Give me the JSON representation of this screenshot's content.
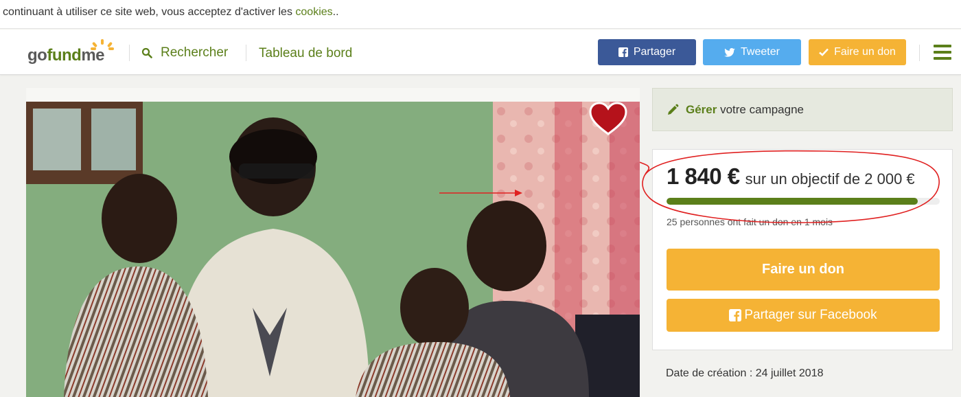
{
  "cookie_bar": {
    "text": "continuant à utiliser ce site web, vous acceptez d'activer les ",
    "link": "cookies",
    "suffix": ".."
  },
  "header": {
    "logo": {
      "go": "go",
      "fund": "fund",
      "me": "me"
    },
    "search_label": "Rechercher",
    "dashboard_label": "Tableau de bord",
    "share_label": "Partager",
    "tweet_label": "Tweeter",
    "donate_label": "Faire un don"
  },
  "campaign": {
    "manage_bold": "Gérer",
    "manage_rest": " votre campagne",
    "raised": "1 840 €",
    "goal_text": "sur un objectif de 2 000 €",
    "progress_fraction": 0.92,
    "donors_text": "25 personnes ont fait un don en 1 mois",
    "donate_button": "Faire un don",
    "share_button": "Partager sur Facebook",
    "creation_date": "Date de création : 24 juillet 2018"
  },
  "colors": {
    "brand_green": "#5b7f1a",
    "facebook": "#3b5998",
    "twitter": "#55acee",
    "donate_orange": "#f5b335",
    "annotation_red": "#e02020",
    "heart_red": "#b5121b"
  },
  "icons": [
    "search-icon",
    "facebook-icon",
    "twitter-icon",
    "check-icon",
    "menu-icon",
    "heart-icon",
    "pencil-icon"
  ]
}
